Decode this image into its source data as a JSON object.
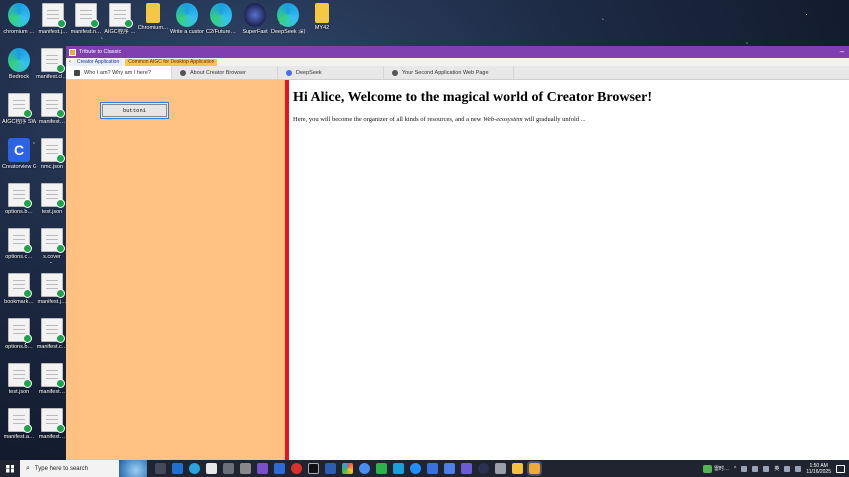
{
  "desktop": {
    "icons": [
      {
        "label": "chromium …",
        "type": "edge"
      },
      {
        "label": "manifest.j…",
        "type": "doc"
      },
      {
        "label": "manifest.n…",
        "type": "doc"
      },
      {
        "label": "AIGC程序 …",
        "type": "doc"
      },
      {
        "label": "Chromium…",
        "type": "folder"
      },
      {
        "label": "Write a custom M…",
        "type": "edge"
      },
      {
        "label": "C2/Future…",
        "type": "edge"
      },
      {
        "label": "SuperFast",
        "type": "dark"
      },
      {
        "label": "DeepSeek 深度思考",
        "type": "edge"
      },
      {
        "label": "MY42",
        "type": "folder"
      },
      {
        "label": "Bedrock",
        "type": "edge"
      },
      {
        "label": "manifest.cl…",
        "type": "doc"
      },
      {
        "label": "AIGC程序 SW AIGC",
        "type": "doc"
      },
      {
        "label": "manifest…",
        "type": "doc"
      },
      {
        "label": "Creatorview Global",
        "type": "blue"
      },
      {
        "label": "nmc.json",
        "type": "doc"
      },
      {
        "label": "options.b…",
        "type": "doc"
      },
      {
        "label": "test.json",
        "type": "doc"
      },
      {
        "label": "options.c…",
        "type": "doc"
      },
      {
        "label": "s.cover",
        "type": "doc"
      },
      {
        "label": "bookmark…",
        "type": "doc"
      },
      {
        "label": "manifest.j…",
        "type": "doc"
      },
      {
        "label": "options.b…",
        "type": "doc"
      },
      {
        "label": "manifest.c…",
        "type": "doc"
      },
      {
        "label": "test.json",
        "type": "doc"
      },
      {
        "label": "manifest…",
        "type": "doc"
      },
      {
        "label": "manifest.a…",
        "type": "doc"
      },
      {
        "label": "manifest…",
        "type": "doc"
      }
    ]
  },
  "window": {
    "title": "Tribute to Classic",
    "minimize_glyph": "–",
    "back_glyph": "‹",
    "menu": [
      "Creator Application",
      "Common AIGC for Desktop Application"
    ],
    "tabs": [
      {
        "label": "Who I am? Why am I here?",
        "icon": "page-icon"
      },
      {
        "label": "About Creator Browser",
        "icon": "globe-icon"
      },
      {
        "label": "DeepSeek",
        "icon": "deepseek-icon"
      },
      {
        "label": "Your Second Application Web Page",
        "icon": "globe-icon"
      }
    ],
    "button1_label": "button1",
    "headline": "Hi Alice, Welcome to the magical world of Creator Browser!",
    "paragraph_pre": "Here, you will become the organizer of all kinds of resources, and a new ",
    "paragraph_em": "Web-ecosystem",
    "paragraph_post": " will gradually unfold ...",
    "colors": {
      "titlebar": "#7e3fb0",
      "left_pane": "#ffc182",
      "divider": "#e8141b"
    }
  },
  "taskbar": {
    "search_placeholder": "Type here to search",
    "search_glyph": "⌕",
    "weather": "雷时…",
    "ime": "英",
    "time": "1:50 AM",
    "date": "11/16/2025"
  }
}
